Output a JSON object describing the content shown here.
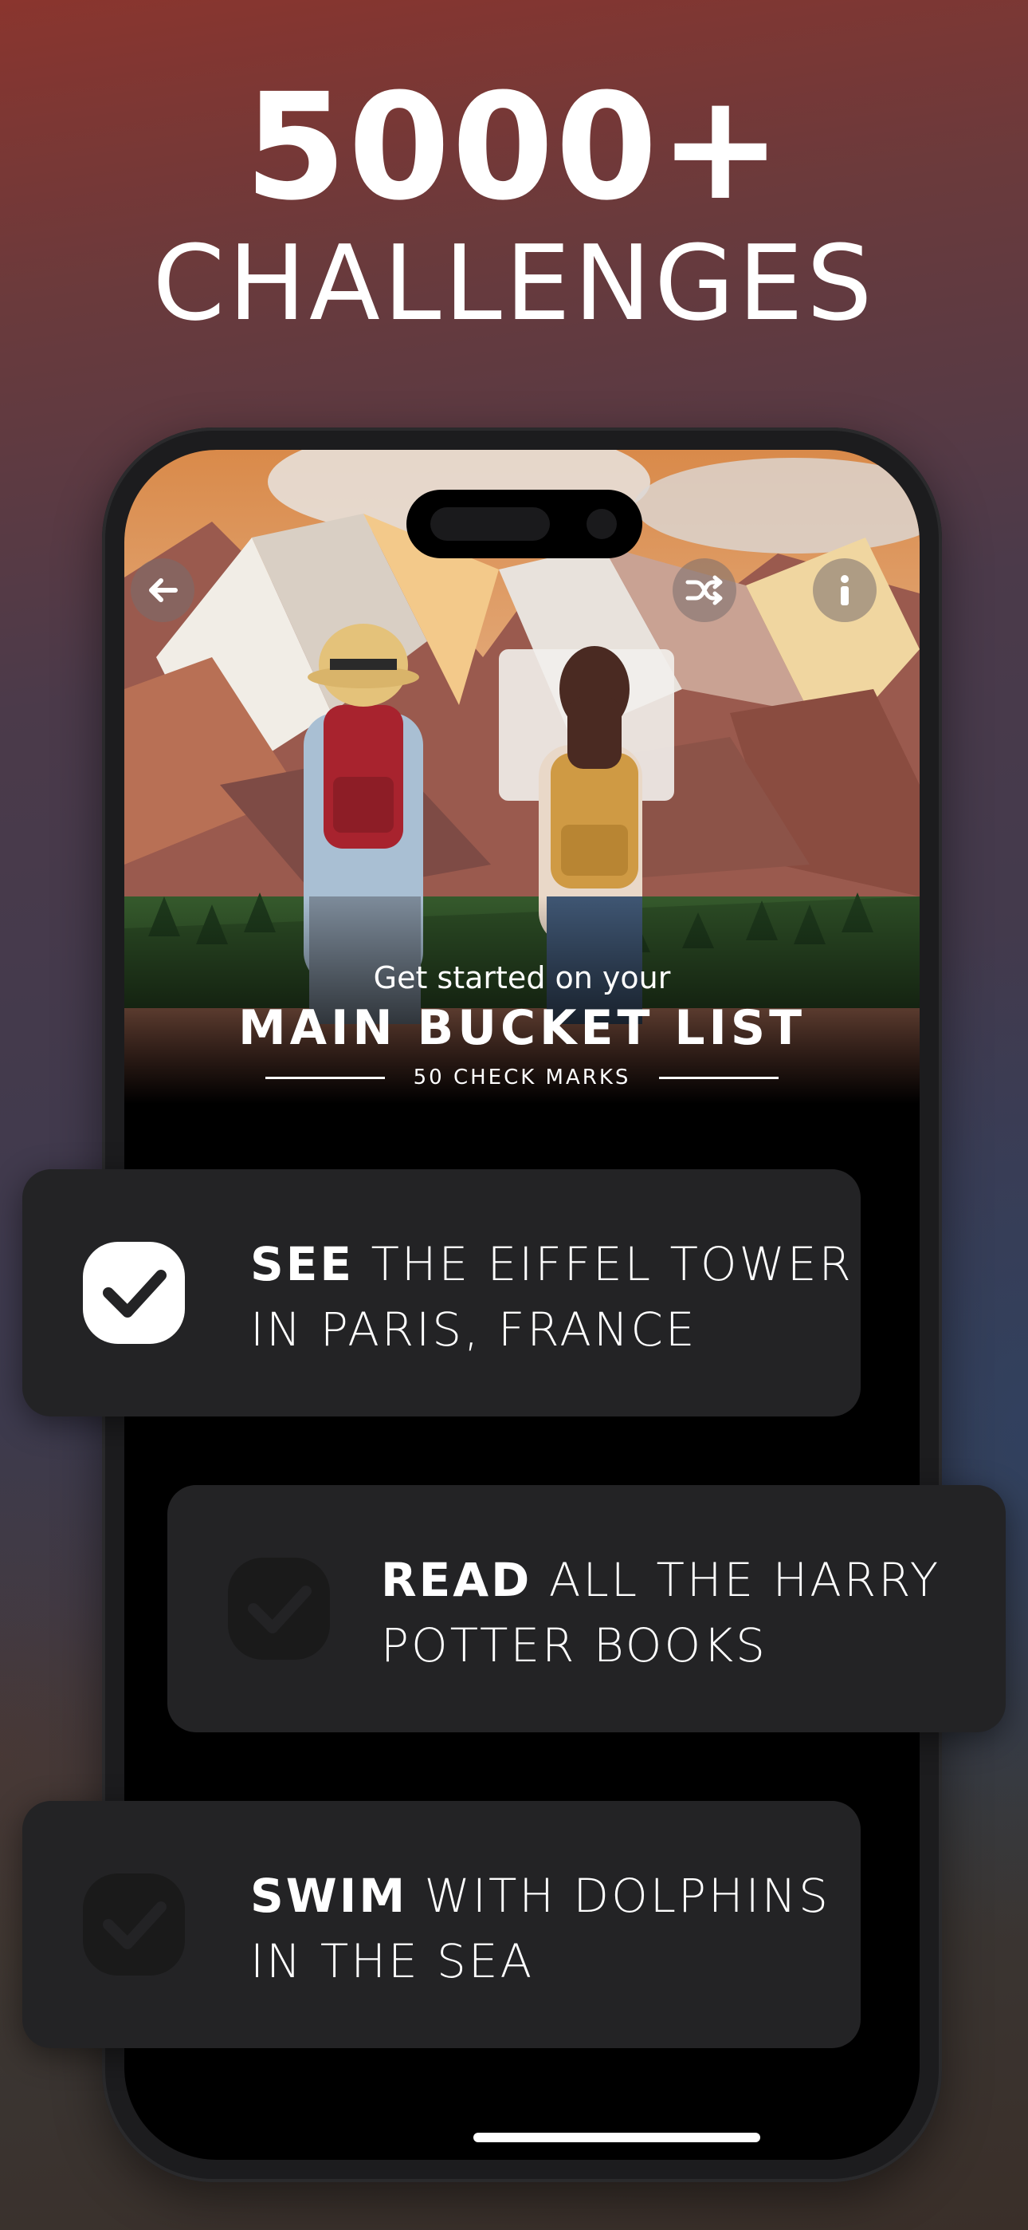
{
  "headline": {
    "line1": "5000+",
    "line2": "CHALLENGES"
  },
  "screen": {
    "hero": {
      "intro": "Get started on your",
      "title": "MAIN BUCKET LIST",
      "subtitle": "50 CHECK MARKS"
    },
    "buttons": {
      "back_icon": "arrow-left-icon",
      "shuffle_icon": "shuffle-icon",
      "info_icon": "info-icon"
    }
  },
  "cards": [
    {
      "verb": "SEE",
      "rest_line1": " THE EIFFEL TOWER",
      "line2": "IN PARIS, FRANCE",
      "checked": true
    },
    {
      "verb": "READ",
      "rest_line1": " ALL THE HARRY",
      "line2": "POTTER BOOKS",
      "checked": false
    },
    {
      "verb": "SWIM",
      "rest_line1": " WITH DOLPHINS",
      "line2": "IN THE SEA",
      "checked": false
    }
  ],
  "colors": {
    "card_bg": "#232325",
    "checked_box": "#ffffff",
    "unchecked_box": "#1a1a1a"
  }
}
